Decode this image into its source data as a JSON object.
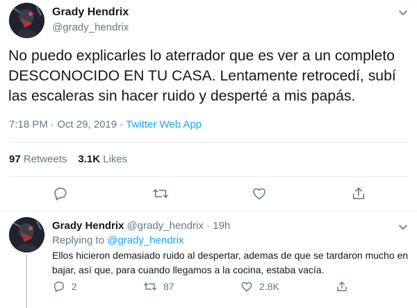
{
  "tweet": {
    "author_name": "Grady Hendrix",
    "author_handle": "@grady_hendrix",
    "text_lines": [
      "No puedo explicarles lo aterrador que es ver a un completo",
      "DESCONOCIDO EN TU CASA. Lentamente retrocedí, subí",
      "las escaleras sin hacer ruido y desperté a mis papás."
    ],
    "time": "7:18 PM",
    "date": "Oct 29, 2019",
    "separator": "·",
    "app": "Twitter Web App",
    "retweets_count": "97",
    "retweets_label": "Retweets",
    "likes_count": "3.1K",
    "likes_label": "Likes",
    "actions": [
      "reply-icon",
      "retweet-icon",
      "like-icon",
      "share-icon"
    ]
  },
  "reply": {
    "author_name": "Grady Hendrix",
    "author_handle": "@grady_hendrix",
    "separator": "·",
    "age": "19h",
    "replying_to_label": "Replying to",
    "replying_to_handle": "@grady_hendrix",
    "text_lines": [
      "Ellos hicieron demasiado ruido al despertar, ademas de que se tardaron mucho en",
      "bajar, así que, para cuando llegamos a la cocina, estaba vacía."
    ],
    "reply_count": "2",
    "retweet_count": "87",
    "like_count": "2.8K"
  },
  "colors": {
    "text": "#14171a",
    "secondary": "#657786",
    "link": "#1da1f2",
    "divider": "#e6ecf0"
  }
}
